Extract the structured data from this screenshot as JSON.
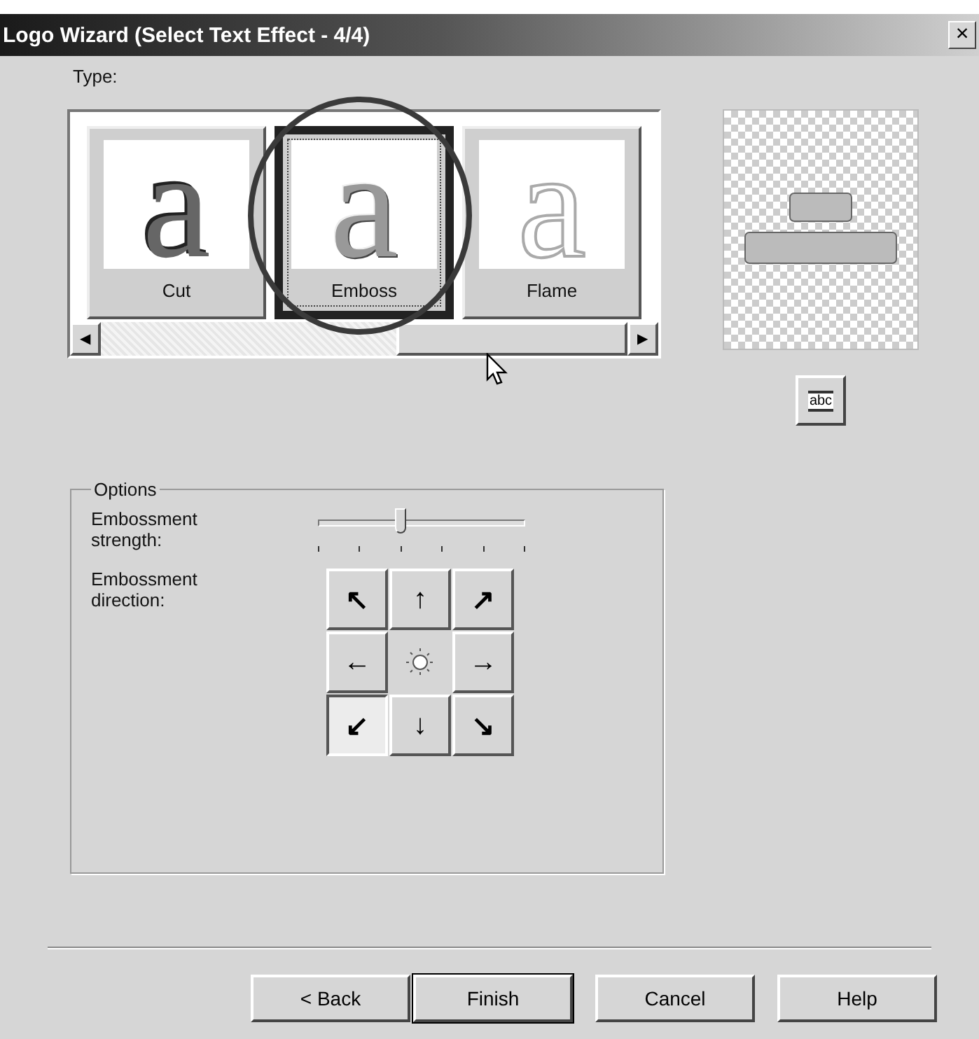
{
  "window": {
    "title": "Logo Wizard (Select Text Effect - 4/4)",
    "close": "×"
  },
  "type_label": "Type:",
  "effects": [
    {
      "label": "Cut",
      "sample": "a",
      "kind": "cut",
      "selected": false
    },
    {
      "label": "Emboss",
      "sample": "a",
      "kind": "emboss",
      "selected": true
    },
    {
      "label": "Flame",
      "sample": "a",
      "kind": "flame",
      "selected": false
    }
  ],
  "scrollbar": {
    "left": "◀",
    "right": "▶"
  },
  "preview_button": {
    "label": "abc"
  },
  "options": {
    "title": "Options",
    "strength": {
      "label": "Embossment strength:",
      "level": 0.4
    },
    "direction": {
      "label": "Embossment direction:",
      "cells": [
        {
          "arrow": "↖",
          "kind": "arrow",
          "selected": false
        },
        {
          "arrow": "↑",
          "kind": "arrow",
          "selected": false
        },
        {
          "arrow": "↗",
          "kind": "arrow",
          "selected": false
        },
        {
          "arrow": "←",
          "kind": "arrow",
          "selected": false
        },
        {
          "kind": "light",
          "selected": false
        },
        {
          "arrow": "→",
          "kind": "arrow",
          "selected": false
        },
        {
          "arrow": "↙",
          "kind": "arrow",
          "selected": true
        },
        {
          "arrow": "↓",
          "kind": "arrow",
          "selected": false
        },
        {
          "arrow": "↘",
          "kind": "arrow",
          "selected": false
        }
      ]
    }
  },
  "buttons": [
    {
      "label": "< Back",
      "default": false
    },
    {
      "label": "Finish",
      "default": true
    },
    {
      "label": "Cancel",
      "default": false
    },
    {
      "label": "Help",
      "default": false
    }
  ]
}
